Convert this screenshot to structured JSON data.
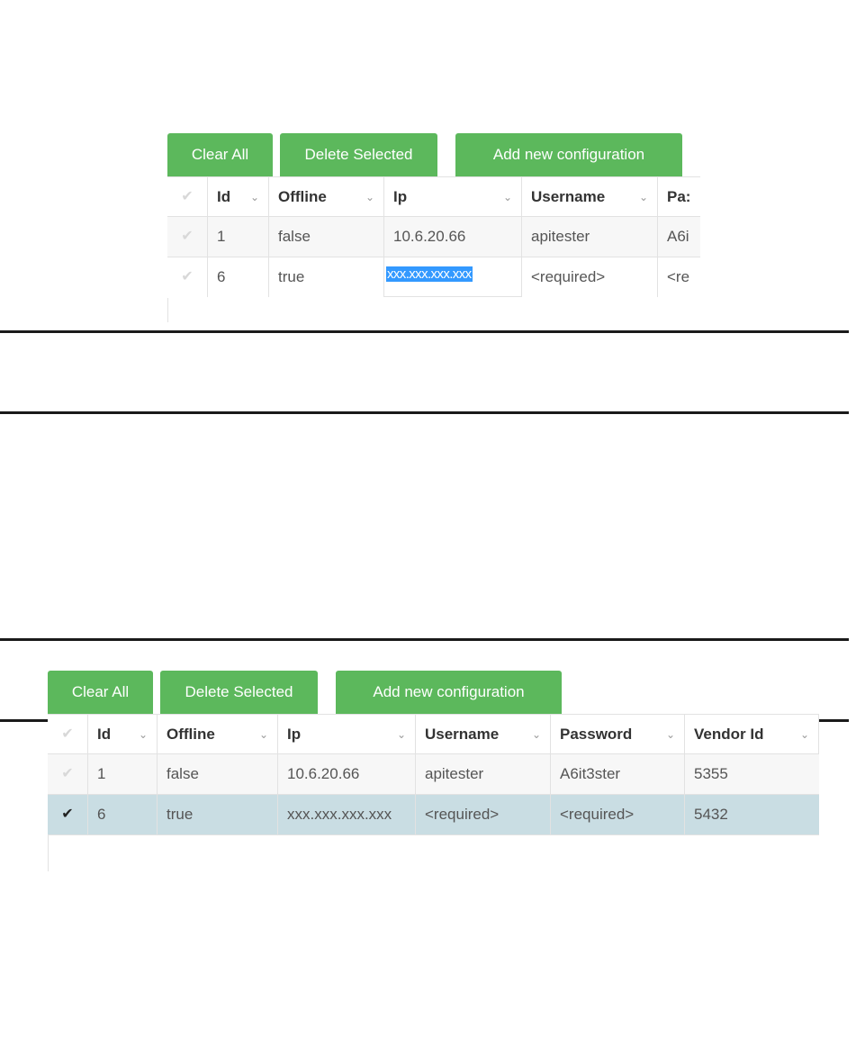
{
  "top_panel": {
    "buttons": {
      "clear_all": "Clear All",
      "delete_selected": "Delete Selected",
      "add_new": "Add new configuration"
    },
    "columns": [
      "Id",
      "Offline",
      "Ip",
      "Username",
      "Pa:"
    ],
    "rows": [
      {
        "id": "1",
        "offline": "false",
        "ip": "10.6.20.66",
        "username": "apitester",
        "password": "A6i"
      },
      {
        "id": "6",
        "offline": "true",
        "ip": "xxx.xxx.xxx.xxx",
        "username": "<required>",
        "password": "<re"
      }
    ]
  },
  "bottom_panel": {
    "buttons": {
      "clear_all": "Clear All",
      "delete_selected": "Delete Selected",
      "add_new": "Add new configuration"
    },
    "columns": [
      "Id",
      "Offline",
      "Ip",
      "Username",
      "Password",
      "Vendor Id"
    ],
    "rows": [
      {
        "id": "1",
        "offline": "false",
        "ip": "10.6.20.66",
        "username": "apitester",
        "password": "A6it3ster",
        "vendor_id": "5355",
        "selected": false
      },
      {
        "id": "6",
        "offline": "true",
        "ip": "xxx.xxx.xxx.xxx",
        "username": "<required>",
        "password": "<required>",
        "vendor_id": "5432",
        "selected": true
      }
    ]
  },
  "icons": {
    "check": "✔",
    "sort": "⌄"
  },
  "colors": {
    "button": "#5cb85c",
    "selected_row": "#c9dde3",
    "text_selection": "#3399ff"
  }
}
